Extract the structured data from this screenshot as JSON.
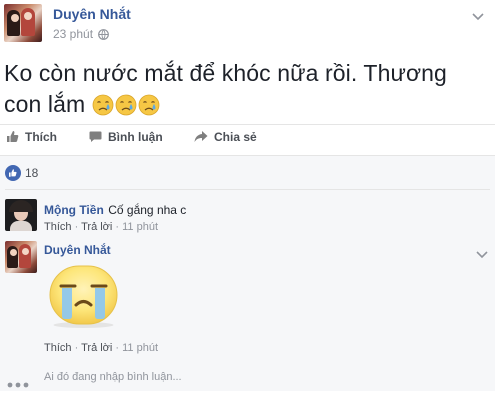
{
  "post": {
    "author": "Duyên Nhắt",
    "time": "23 phút",
    "text": "Ko còn nước mắt để khóc nữa rồi. Thương con lắm",
    "emoji_count": 3
  },
  "actions": {
    "like": "Thích",
    "comment": "Bình luận",
    "share": "Chia sẻ"
  },
  "reactions": {
    "count": "18"
  },
  "comments": [
    {
      "author": "Mộng Tiền",
      "text": "Cố gắng nha c",
      "like": "Thích",
      "reply": "Trả lời",
      "time": "11 phút"
    },
    {
      "author": "Duyên Nhắt",
      "text": "",
      "sticker": "crying-face-sticker",
      "like": "Thích",
      "reply": "Trả lời",
      "time": "11 phút"
    }
  ],
  "composer": {
    "placeholder": "Ai đó đang nhập bình luận..."
  },
  "colors": {
    "link_blue": "#365899",
    "like_blue": "#4267b2",
    "meta_grey": "#90949c"
  }
}
